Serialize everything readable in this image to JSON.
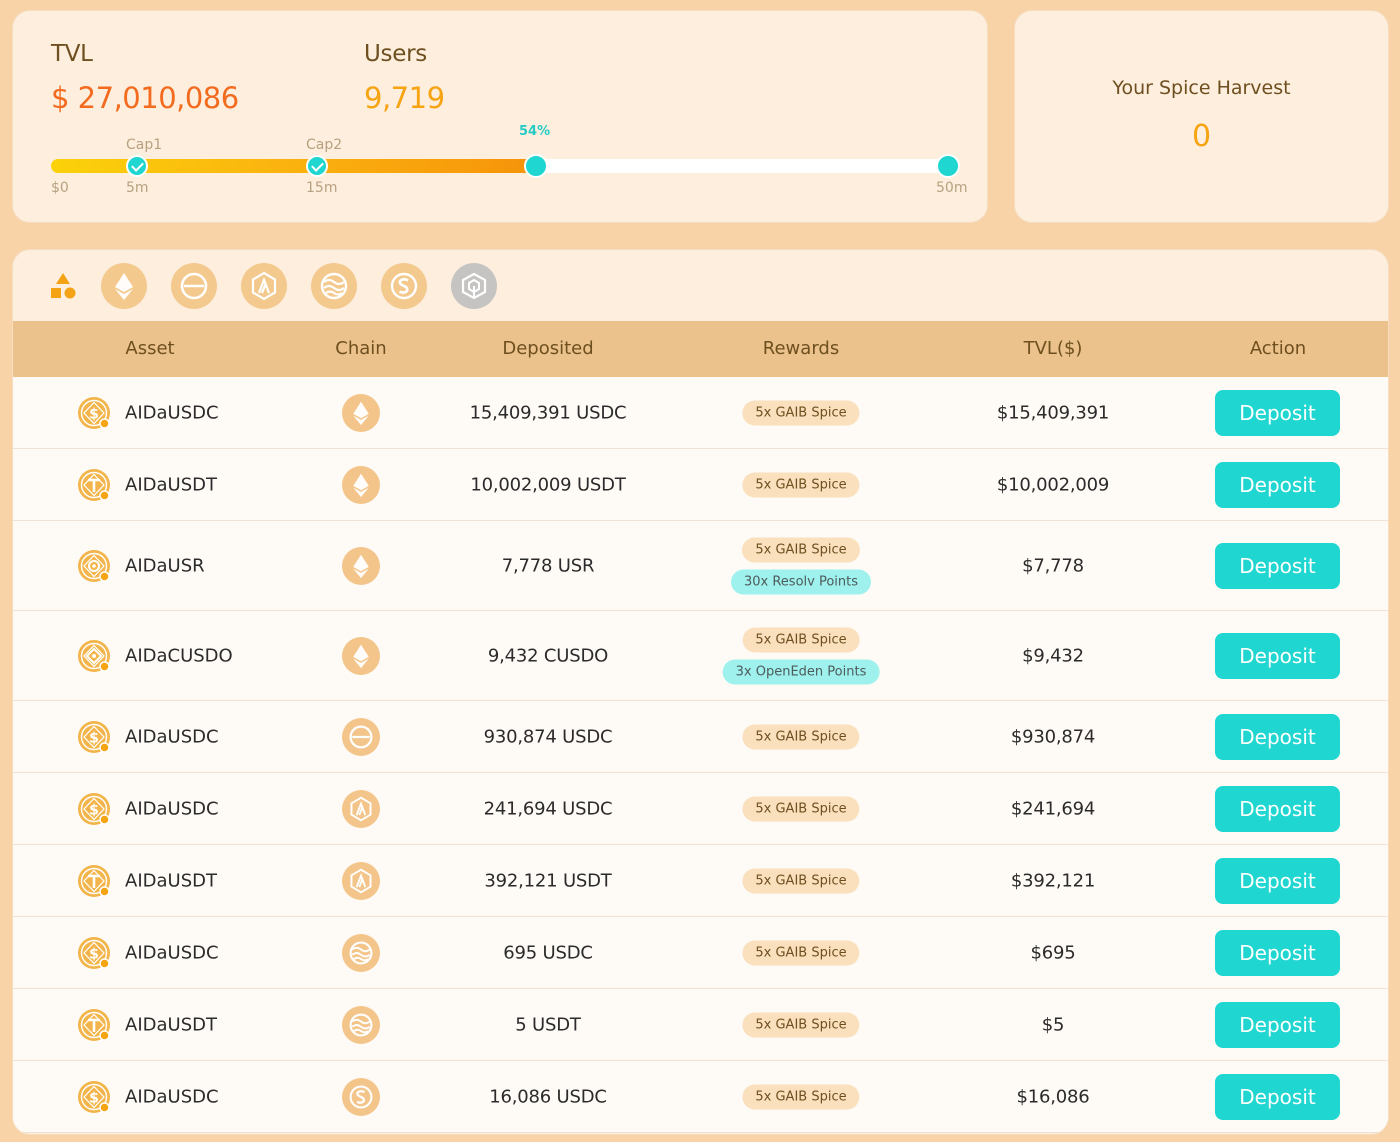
{
  "stats": {
    "tvl_label": "TVL",
    "tvl_value": "$ 27,010,086",
    "users_label": "Users",
    "users_value": "9,719",
    "progress": {
      "fraction": 0.54,
      "percent_label": "54%",
      "cap1_label": "Cap1",
      "cap2_label": "Cap2",
      "min_label": "$0",
      "cap1_value": "5m",
      "cap2_value": "15m",
      "max_label": "50m"
    }
  },
  "harvest": {
    "title": "Your Spice Harvest",
    "value": "0"
  },
  "filters": [
    {
      "name": "all-chains-icon"
    },
    {
      "name": "ethereum-icon"
    },
    {
      "name": "chain-minus-icon"
    },
    {
      "name": "arbitrum-icon"
    },
    {
      "name": "sei-icon"
    },
    {
      "name": "sonic-icon"
    },
    {
      "name": "bnb-chain-icon"
    }
  ],
  "table": {
    "headers": {
      "asset": "Asset",
      "chain": "Chain",
      "deposited": "Deposited",
      "rewards": "Rewards",
      "tvl": "TVL($)",
      "action": "Action"
    },
    "deposit_label": "Deposit",
    "rows": [
      {
        "asset": "AIDaUSDC",
        "asset_icon": "usdc",
        "chain": "ethereum",
        "deposited": "15,409,391 USDC",
        "rewards": [
          "5x GAIB Spice"
        ],
        "tvl": "$15,409,391"
      },
      {
        "asset": "AIDaUSDT",
        "asset_icon": "usdt",
        "chain": "ethereum",
        "deposited": "10,002,009 USDT",
        "rewards": [
          "5x GAIB Spice"
        ],
        "tvl": "$10,002,009"
      },
      {
        "asset": "AIDaUSR",
        "asset_icon": "usr",
        "chain": "ethereum",
        "deposited": "7,778 USR",
        "rewards": [
          "5x GAIB Spice",
          "30x Resolv Points"
        ],
        "tvl": "$7,778"
      },
      {
        "asset": "AIDaCUSDO",
        "asset_icon": "cusdo",
        "chain": "ethereum",
        "deposited": "9,432 CUSDO",
        "rewards": [
          "5x GAIB Spice",
          "3x OpenEden Points"
        ],
        "tvl": "$9,432"
      },
      {
        "asset": "AIDaUSDC",
        "asset_icon": "usdc",
        "chain": "minus",
        "deposited": "930,874 USDC",
        "rewards": [
          "5x GAIB Spice"
        ],
        "tvl": "$930,874"
      },
      {
        "asset": "AIDaUSDC",
        "asset_icon": "usdc",
        "chain": "arbitrum",
        "deposited": "241,694 USDC",
        "rewards": [
          "5x GAIB Spice"
        ],
        "tvl": "$241,694"
      },
      {
        "asset": "AIDaUSDT",
        "asset_icon": "usdt",
        "chain": "arbitrum",
        "deposited": "392,121 USDT",
        "rewards": [
          "5x GAIB Spice"
        ],
        "tvl": "$392,121"
      },
      {
        "asset": "AIDaUSDC",
        "asset_icon": "usdc",
        "chain": "sei",
        "deposited": "695 USDC",
        "rewards": [
          "5x GAIB Spice"
        ],
        "tvl": "$695"
      },
      {
        "asset": "AIDaUSDT",
        "asset_icon": "usdt",
        "chain": "sei",
        "deposited": "5 USDT",
        "rewards": [
          "5x GAIB Spice"
        ],
        "tvl": "$5"
      },
      {
        "asset": "AIDaUSDC",
        "asset_icon": "usdc",
        "chain": "sonic",
        "deposited": "16,086 USDC",
        "rewards": [
          "5x GAIB Spice"
        ],
        "tvl": "$16,086"
      }
    ]
  },
  "colors": {
    "accent_teal": "#1fd6d0",
    "tvl_orange": "#f26b1f",
    "users_orange": "#f6a412",
    "header_tan": "#ebc28c"
  }
}
